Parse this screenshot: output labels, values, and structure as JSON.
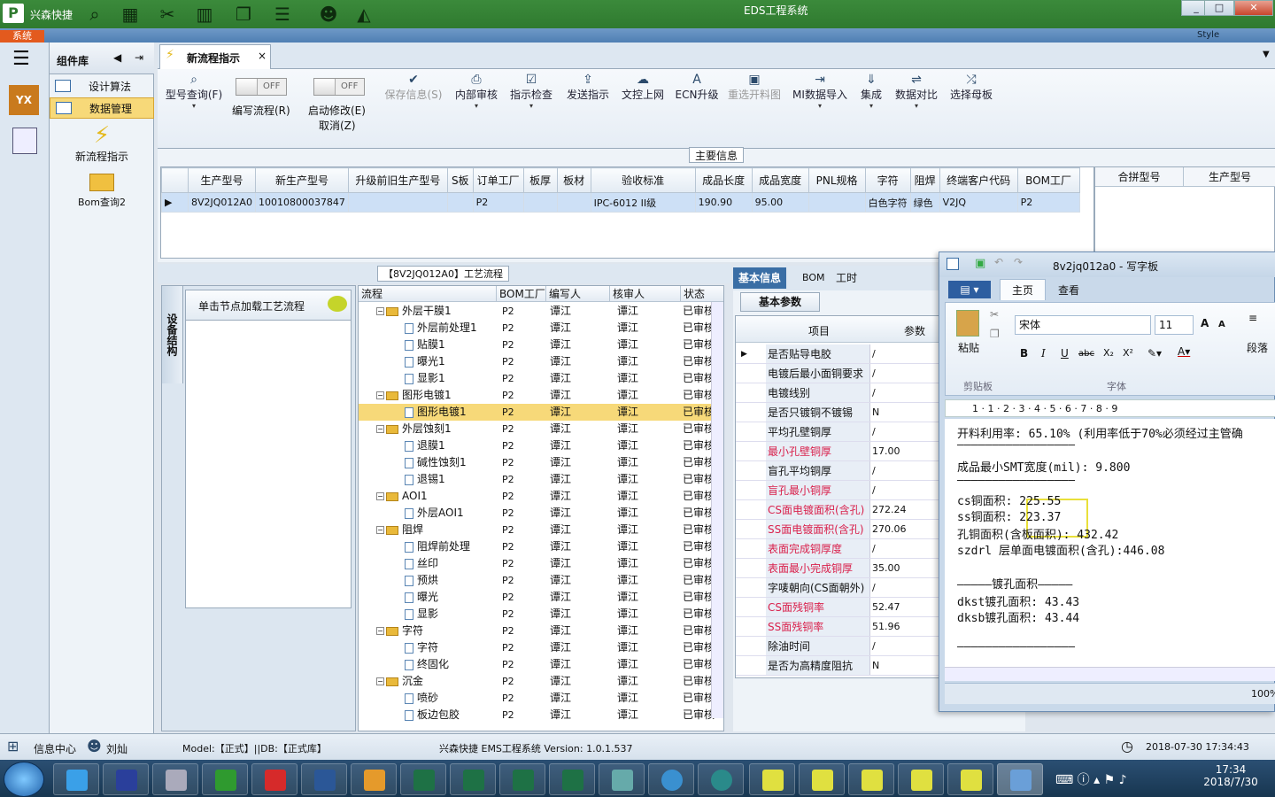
{
  "app": {
    "logo": "P",
    "name": "兴森快捷",
    "window_title": "EDS工程系统",
    "sys_tab": "系统",
    "style_label": "Style"
  },
  "window_buttons": [
    "_",
    "□",
    "✕"
  ],
  "component_lib": {
    "title": "组件库",
    "items": [
      {
        "label": "设计算法"
      },
      {
        "label": "数据管理"
      }
    ],
    "big_items": [
      {
        "label": "新流程指示"
      },
      {
        "label": "Bom查询2"
      }
    ]
  },
  "left_logo": "YX",
  "tab": {
    "label": "新流程指示",
    "close": "×"
  },
  "toolbar": {
    "buttons": [
      {
        "label": "型号查询(F)",
        "icon": "⌕"
      },
      {
        "label": "保存信息(S)",
        "icon": "✔",
        "disabled": true
      },
      {
        "label": "内部审核",
        "icon": "⎙"
      },
      {
        "label": "指示检查",
        "icon": "☑"
      },
      {
        "label": "发送指示",
        "icon": "⇪"
      },
      {
        "label": "文控上网",
        "icon": "☁"
      },
      {
        "label": "ECN升级",
        "icon": "A"
      },
      {
        "label": "重选开料图",
        "icon": "▣",
        "disabled": true
      },
      {
        "label": "MI数据导入",
        "icon": "⇥"
      },
      {
        "label": "集成",
        "icon": "⇓"
      },
      {
        "label": "数据对比",
        "icon": "⇌"
      },
      {
        "label": "选择母板",
        "icon": "⤮"
      }
    ],
    "toggles": [
      {
        "state": "OFF",
        "label": "编写流程(R)"
      },
      {
        "state": "OFF",
        "label": "启动修改(E)",
        "label2": "取消(Z)"
      }
    ]
  },
  "main_info": {
    "title": "主要信息",
    "headers": [
      "生产型号",
      "新生产型号",
      "升级前旧生产型号",
      "S板",
      "订单工厂",
      "板厚",
      "板材",
      "验收标准",
      "成品长度",
      "成品宽度",
      "PNL规格",
      "字符",
      "阻焊",
      "终端客户代码",
      "BOM工厂"
    ],
    "right_headers": [
      "合拼型号",
      "生产型号"
    ],
    "row": [
      "8V2JQ012A0",
      "10010800037847",
      "",
      "",
      "P2",
      "",
      "",
      "IPC-6012 II级",
      "190.90",
      "95.00",
      "",
      "白色字符",
      "绿色",
      "V2JQ",
      "P2"
    ]
  },
  "flow": {
    "title": "【8V2JQ012A0】工艺流程",
    "side_tab": "设备结构",
    "node_hint": "单击节点加载工艺流程",
    "headers": [
      "流程",
      "BOM工厂",
      "编写人",
      "核审人",
      "状态"
    ],
    "rows": [
      {
        "name": "外层干膜1",
        "lvl": 0,
        "bom": "P2",
        "w": "谭江",
        "r": "谭江",
        "s": "已审核"
      },
      {
        "name": "外层前处理1",
        "lvl": 1,
        "bom": "P2",
        "w": "谭江",
        "r": "谭江",
        "s": "已审核"
      },
      {
        "name": "贴膜1",
        "lvl": 1,
        "bom": "P2",
        "w": "谭江",
        "r": "谭江",
        "s": "已审核"
      },
      {
        "name": "曝光1",
        "lvl": 1,
        "bom": "P2",
        "w": "谭江",
        "r": "谭江",
        "s": "已审核"
      },
      {
        "name": "显影1",
        "lvl": 1,
        "bom": "P2",
        "w": "谭江",
        "r": "谭江",
        "s": "已审核"
      },
      {
        "name": "图形电镀1",
        "lvl": 0,
        "bom": "P2",
        "w": "谭江",
        "r": "谭江",
        "s": "已审核"
      },
      {
        "name": "图形电镀1",
        "lvl": 1,
        "bom": "P2",
        "w": "谭江",
        "r": "谭江",
        "s": "已审核",
        "sel": true
      },
      {
        "name": "外层蚀刻1",
        "lvl": 0,
        "bom": "P2",
        "w": "谭江",
        "r": "谭江",
        "s": "已审核"
      },
      {
        "name": "退膜1",
        "lvl": 1,
        "bom": "P2",
        "w": "谭江",
        "r": "谭江",
        "s": "已审核"
      },
      {
        "name": "碱性蚀刻1",
        "lvl": 1,
        "bom": "P2",
        "w": "谭江",
        "r": "谭江",
        "s": "已审核"
      },
      {
        "name": "退锡1",
        "lvl": 1,
        "bom": "P2",
        "w": "谭江",
        "r": "谭江",
        "s": "已审核"
      },
      {
        "name": "AOI1",
        "lvl": 0,
        "bom": "P2",
        "w": "谭江",
        "r": "谭江",
        "s": "已审核"
      },
      {
        "name": "外层AOI1",
        "lvl": 1,
        "bom": "P2",
        "w": "谭江",
        "r": "谭江",
        "s": "已审核"
      },
      {
        "name": "阻焊",
        "lvl": 0,
        "bom": "P2",
        "w": "谭江",
        "r": "谭江",
        "s": "已审核"
      },
      {
        "name": "阻焊前处理",
        "lvl": 1,
        "bom": "P2",
        "w": "谭江",
        "r": "谭江",
        "s": "已审核"
      },
      {
        "name": "丝印",
        "lvl": 1,
        "bom": "P2",
        "w": "谭江",
        "r": "谭江",
        "s": "已审核"
      },
      {
        "name": "预烘",
        "lvl": 1,
        "bom": "P2",
        "w": "谭江",
        "r": "谭江",
        "s": "已审核"
      },
      {
        "name": "曝光",
        "lvl": 1,
        "bom": "P2",
        "w": "谭江",
        "r": "谭江",
        "s": "已审核"
      },
      {
        "name": "显影",
        "lvl": 1,
        "bom": "P2",
        "w": "谭江",
        "r": "谭江",
        "s": "已审核"
      },
      {
        "name": "字符",
        "lvl": 0,
        "bom": "P2",
        "w": "谭江",
        "r": "谭江",
        "s": "已审核"
      },
      {
        "name": "字符",
        "lvl": 1,
        "bom": "P2",
        "w": "谭江",
        "r": "谭江",
        "s": "已审核"
      },
      {
        "name": "终固化",
        "lvl": 1,
        "bom": "P2",
        "w": "谭江",
        "r": "谭江",
        "s": "已审核"
      },
      {
        "name": "沉金",
        "lvl": 0,
        "bom": "P2",
        "w": "谭江",
        "r": "谭江",
        "s": "已审核"
      },
      {
        "name": "喷砂",
        "lvl": 1,
        "bom": "P2",
        "w": "谭江",
        "r": "谭江",
        "s": "已审核"
      },
      {
        "name": "板边包胶",
        "lvl": 1,
        "bom": "P2",
        "w": "谭江",
        "r": "谭江",
        "s": "已审核"
      }
    ]
  },
  "basic": {
    "tabs": [
      "基本信息",
      "BOM",
      "工时"
    ],
    "sub_tab": "基本参数",
    "col_item": "项目",
    "col_param": "参数",
    "rows": [
      {
        "name": "是否贴导电胶",
        "val": "/",
        "red": false
      },
      {
        "name": "电镀后最小面铜要求",
        "val": "/",
        "red": false
      },
      {
        "name": "电镀线别",
        "val": "/",
        "red": false
      },
      {
        "name": "是否只镀铜不镀锡",
        "val": "N",
        "red": false
      },
      {
        "name": "平均孔壁铜厚",
        "val": "/",
        "red": false
      },
      {
        "name": "最小孔壁铜厚",
        "val": "17.00",
        "red": true
      },
      {
        "name": "盲孔平均铜厚",
        "val": "/",
        "red": false
      },
      {
        "name": "盲孔最小铜厚",
        "val": "/",
        "red": true
      },
      {
        "name": "CS面电镀面积(含孔)",
        "val": "272.24",
        "red": true
      },
      {
        "name": "SS面电镀面积(含孔)",
        "val": "270.06",
        "red": true
      },
      {
        "name": "表面完成铜厚度",
        "val": "/",
        "red": true
      },
      {
        "name": "表面最小完成铜厚",
        "val": "35.00",
        "red": true
      },
      {
        "name": "字唛朝向(CS面朝外)",
        "val": "/",
        "red": false
      },
      {
        "name": "CS面残铜率",
        "val": "52.47",
        "red": true
      },
      {
        "name": "SS面残铜率",
        "val": "51.96",
        "red": true
      },
      {
        "name": "除油时间",
        "val": "/",
        "red": false
      },
      {
        "name": "是否为高精度阻抗",
        "val": "N",
        "red": false
      }
    ]
  },
  "wordpad": {
    "title": "8v2jq012a0 - 写字板",
    "tabs": [
      "主页",
      "查看"
    ],
    "paste": "粘贴",
    "clipboard": "剪贴板",
    "font_group": "字体",
    "font": "宋体",
    "size": "11",
    "para": "段落",
    "zoom": "100%",
    "ruler": "1 · 1 · 2 · 3 · 4 · 5 · 6 · 7 · 8 · 9",
    "lines": [
      "开料利用率: 65.10% (利用率低于70%必须经过主管确",
      "—————————————————",
      "成品最小SMT宽度(mil): 9.800",
      "—————————————————",
      "cs铜面积: 225.55",
      "ss铜面积: 223.37",
      "孔铜面积(含板面积): 432.42",
      "szdrl        层单面电镀面积(含孔):446.08",
      "",
      "—————镀孔面积—————",
      "dkst镀孔面积: 43.43",
      "dksb镀孔面积: 43.44",
      "",
      "—————————————————"
    ]
  },
  "status": {
    "info_center": "信息中心",
    "user": "刘灿",
    "model": "Model:【正式】||DB:【正式库】",
    "version": "兴森快捷 EMS工程系统 Version: 1.0.1.537",
    "datetime": "2018-07-30 17:34:43"
  },
  "taskbar": {
    "time": "17:34",
    "date": "2018/7/30"
  },
  "colors": {
    "green": "#2f7a2f",
    "blue": "#3a6ea5",
    "highlight": "#f7d979"
  }
}
